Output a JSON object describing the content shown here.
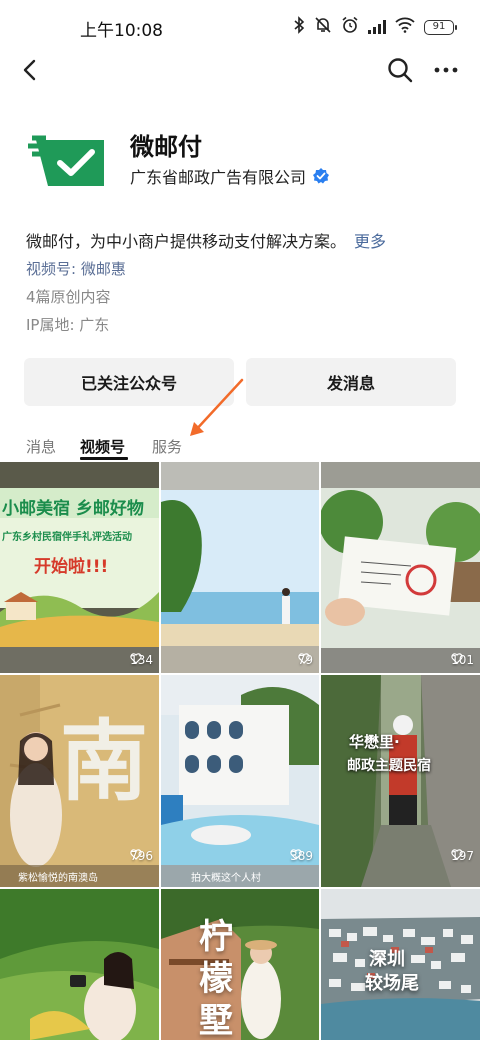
{
  "status": {
    "time": "上午10:08",
    "battery": "91"
  },
  "profile": {
    "name": "微邮付",
    "company": "广东省邮政广告有限公司",
    "description": "微邮付，为中小商户提供移动支付解决方案。",
    "more_label": "更多",
    "channel_prefix": "视频号: ",
    "channel_name": "微邮惠",
    "original_count": "4篇原创内容",
    "ip_location": "IP属地: 广东"
  },
  "actions": {
    "follow_label": "已关注公众号",
    "message_label": "发消息"
  },
  "tabs": [
    {
      "label": "消息"
    },
    {
      "label": "视频号"
    },
    {
      "label": "服务"
    }
  ],
  "videos": [
    {
      "likes": "134",
      "title_line1": "小邮美宿 乡邮好物",
      "title_line2": "广东乡村民宿伴手礼评选活动",
      "title_line3": "开始啦!!!"
    },
    {
      "likes": "79"
    },
    {
      "likes": "101"
    },
    {
      "likes": "796",
      "big_char": "南",
      "caption": "紫松愉悦的南澳岛"
    },
    {
      "likes": "389",
      "caption": "拍大概这个人村"
    },
    {
      "likes": "197",
      "title_line1": "华懋里·",
      "title_line2": "邮政主题民宿"
    },
    {
      "likes": "",
      "title_line1": "柠",
      "title_line2": "檬",
      "title_line3": "墅"
    },
    {
      "likes": "",
      "title_line1": "深圳",
      "title_line2": "较场尾"
    }
  ],
  "colors": {
    "brand_green": "#1f9a58",
    "link_blue": "#5b6f96",
    "annotation_orange": "#f26b2a",
    "verified_blue": "#2a7ff0"
  }
}
